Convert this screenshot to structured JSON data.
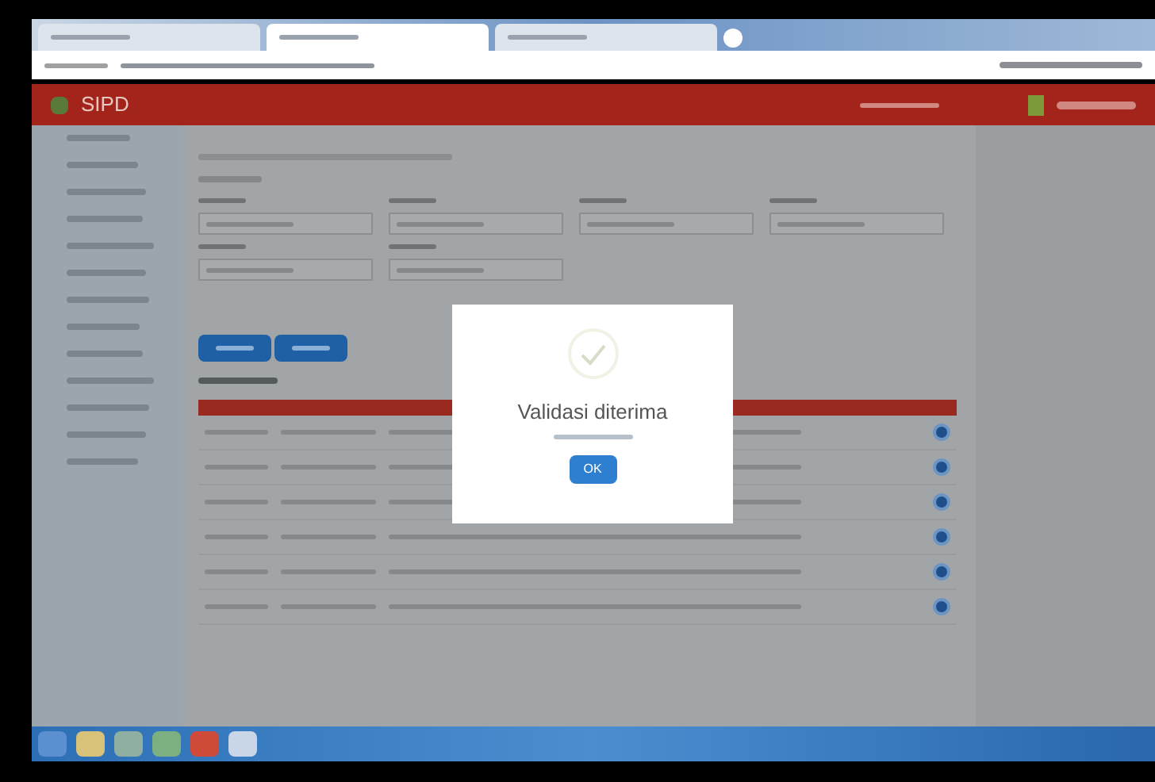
{
  "browser": {
    "tabs": [
      {
        "selected": false
      },
      {
        "selected": true
      },
      {
        "selected": false
      }
    ]
  },
  "app": {
    "title": "SIPD"
  },
  "dialog": {
    "title": "Validasi diterima",
    "button": "OK"
  }
}
